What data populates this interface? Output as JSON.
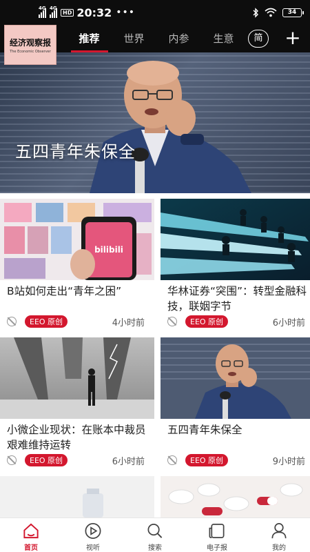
{
  "status_bar": {
    "signal1_label": "4G",
    "signal2_label": "4G",
    "hd_label": "HD",
    "time": "20:32",
    "more_dots": "•••",
    "battery": "34"
  },
  "header": {
    "logo_title": "经济观察报",
    "logo_subtitle": "The Economic Observer",
    "tabs": [
      {
        "label": "推荐"
      },
      {
        "label": "世界"
      },
      {
        "label": "内参"
      },
      {
        "label": "生意"
      }
    ],
    "simplified_label": "简",
    "add_label": "+"
  },
  "hero": {
    "title": "五四青年朱保全"
  },
  "cards": [
    {
      "title": "B站如何走出“青年之困”",
      "badge": "EEO 原创",
      "time": "4小时前",
      "thumb_text": "bilibili"
    },
    {
      "title": "华林证券“突围”：转型金融科技，联姻字节",
      "badge": "EEO 原创",
      "time": "6小时前"
    },
    {
      "title": "小微企业现状：在账本中裁员 艰难维持运转",
      "badge": "EEO 原创",
      "time": "6小时前"
    },
    {
      "title": "五四青年朱保全",
      "badge": "EEO 原创",
      "time": "9小时前"
    }
  ],
  "bottom_nav": [
    {
      "label": "首页",
      "icon": "home-icon"
    },
    {
      "label": "视听",
      "icon": "play-icon"
    },
    {
      "label": "搜索",
      "icon": "search-icon"
    },
    {
      "label": "电子报",
      "icon": "newspaper-icon"
    },
    {
      "label": "我的",
      "icon": "user-icon"
    }
  ],
  "colors": {
    "accent": "#d3172e",
    "header_bg": "#0d0d0d"
  }
}
